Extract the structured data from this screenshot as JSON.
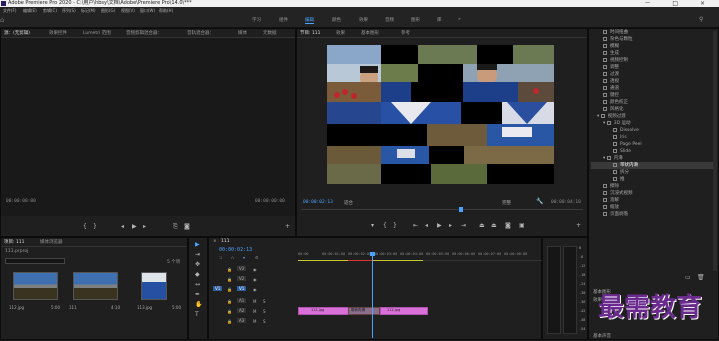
{
  "titlebar": {
    "title": "Adobe Premiere Pro 2020 - C:\\用户\\hbsy\\文档\\Adobe\\Premiere Pro\\14.0\\***",
    "controls": "－ □ ×"
  },
  "menu": [
    "文件(F)",
    "编辑(E)",
    "剪辑(C)",
    "序列(S)",
    "标记(M)",
    "图形(G)",
    "视图(V)",
    "窗口(W)",
    "帮助(H)"
  ],
  "workspaces": [
    "学习",
    "组件",
    "编辑",
    "颜色",
    "效果",
    "音频",
    "图形",
    "库",
    "»"
  ],
  "source_panel": {
    "tabs": [
      "源：(无剪辑)",
      "效果控件",
      "Lumetri 范围",
      "音频剪辑混合器：",
      "音轨混合器：",
      "媒体",
      "元数据"
    ],
    "timecode_left": "00:00:00:00",
    "timecode_right": "00:00:00:00"
  },
  "program_panel": {
    "tabs": [
      "节目: 111",
      "效果",
      "基本图形",
      "参考"
    ],
    "timecode_left": "00:00:02:13",
    "fit": "适合",
    "quality": "完整",
    "timecode_right": "00:00:04:10"
  },
  "effects_panel": {
    "items": [
      {
        "label": "时间扭曲",
        "sel": false
      },
      {
        "label": "杂色与颗粒",
        "sel": false
      },
      {
        "label": "模糊",
        "sel": false
      },
      {
        "label": "生成",
        "sel": false
      },
      {
        "label": "视频控制",
        "sel": false
      },
      {
        "label": "调整",
        "sel": false
      },
      {
        "label": "过渡",
        "sel": false
      },
      {
        "label": "透视",
        "sel": false
      },
      {
        "label": "通道",
        "sel": false
      },
      {
        "label": "键控",
        "sel": false
      },
      {
        "label": "颜色校正",
        "sel": false
      },
      {
        "label": "风格化",
        "sel": false
      },
      {
        "label": "视频过渡",
        "sel": false
      },
      {
        "label": "3D 运动",
        "sel": false
      },
      {
        "label": "Dissolve",
        "sel": false
      },
      {
        "label": "Iris",
        "sel": false
      },
      {
        "label": "Page Peel",
        "sel": false
      },
      {
        "label": "Slide",
        "sel": false
      },
      {
        "label": "内滑",
        "sel": false
      },
      {
        "label": "带状内滑",
        "sel": true
      },
      {
        "label": "拆分",
        "sel": false
      },
      {
        "label": "推",
        "sel": false
      },
      {
        "label": "擦除",
        "sel": false
      },
      {
        "label": "沉浸式视频",
        "sel": false
      },
      {
        "label": "溶解",
        "sel": false
      },
      {
        "label": "缩放",
        "sel": false
      },
      {
        "label": "页面剥落",
        "sel": false
      }
    ],
    "footer": [
      "基本图形",
      "效果",
      "基本声音"
    ]
  },
  "project_panel": {
    "tabs": [
      "项目: 111",
      "媒体浏览器"
    ],
    "path": "111.prproj",
    "count": "5 个项",
    "items": [
      {
        "name": "112.jpg",
        "dur": "5:00"
      },
      {
        "name": "111",
        "dur": "4:10"
      },
      {
        "name": "113.jpg",
        "dur": "5:00"
      }
    ]
  },
  "timeline": {
    "tab": "111",
    "timecode": "00:00:02:13",
    "ruler": [
      "00:00",
      "00:00:01:00",
      "00:00:02:00",
      "00:00:03:00",
      "00:00:04:00",
      "00:00:05:00",
      "00:00:06:00",
      "00:00:07:00",
      "00:00:08:00"
    ],
    "tracks": [
      "V3",
      "V2",
      "V1",
      "A1",
      "A2",
      "A3"
    ],
    "clips": [
      {
        "label": "111.jpg",
        "color": "#d870d8"
      },
      {
        "label": "带状内滑",
        "color": "#8c6e8c"
      },
      {
        "label": "112.jpg",
        "color": "#d870d8"
      }
    ]
  },
  "meters": [
    "0",
    "-6",
    "-12",
    "-18",
    "-24",
    "-30",
    "-36",
    "-42",
    "-48",
    "-54"
  ],
  "watermark": "最需教育"
}
